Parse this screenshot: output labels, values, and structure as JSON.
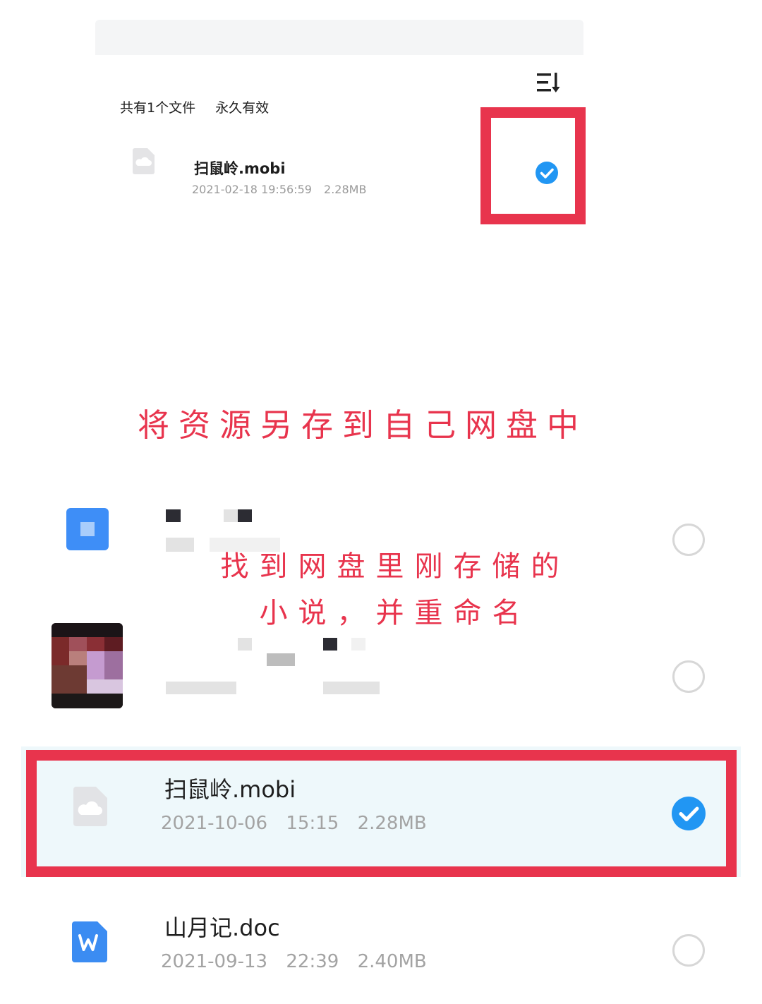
{
  "share": {
    "file_count_text": "共有1个文件",
    "validity_text": "永久有效",
    "file": {
      "name": "扫鼠岭.mobi",
      "date": "2021-02-18 19:56:59",
      "size": "2.28MB",
      "selected": true
    }
  },
  "annotations": {
    "save_to_disk": "将资源另存到自己网盘中",
    "find_and_rename": "找到网盘里刚存储的小说，并重命名"
  },
  "list": {
    "files": [
      {
        "name": "扫鼠岭.mobi",
        "date": "2021-10-06",
        "time": "15:15",
        "size": "2.28MB",
        "selected": true
      },
      {
        "name": "山月记.doc",
        "date": "2021-09-13",
        "time": "22:39",
        "size": "2.40MB",
        "selected": false
      }
    ]
  },
  "colors": {
    "accent_blue": "#2196f3",
    "highlight_red": "#e8344d",
    "selected_row_bg": "#eef8fb"
  },
  "icons": [
    "sort-icon",
    "cloud-file-icon",
    "check-circle-icon",
    "folder-icon",
    "word-doc-icon",
    "radio-empty-icon"
  ]
}
